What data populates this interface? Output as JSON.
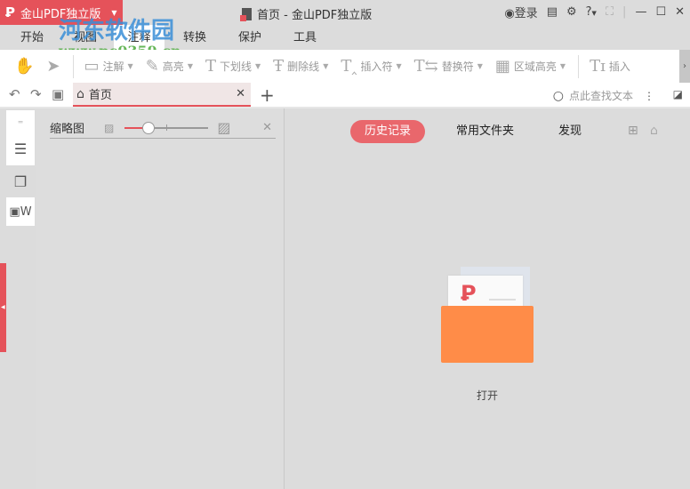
{
  "app": {
    "name": "金山PDF独立版",
    "window_title": "首页 - 金山PDF独立版",
    "login": "登录"
  },
  "watermark": {
    "name": "河东软件园",
    "url": "www.pc0359.cn"
  },
  "menu_tabs": [
    "开始",
    "视图",
    "注释",
    "转换",
    "保护",
    "工具"
  ],
  "active_menu_tab": "注释",
  "toolbar": {
    "items": [
      "注解",
      "高亮",
      "下划线",
      "删除线",
      "插入符",
      "替换符",
      "区域高亮",
      "插入"
    ]
  },
  "doc_tabs": [
    {
      "label": "首页"
    }
  ],
  "search": {
    "placeholder": "点此查找文本"
  },
  "thumbnail_panel": {
    "title": "缩略图",
    "zoom_level": 0.1
  },
  "main": {
    "tabs": [
      "历史记录",
      "常用文件夹",
      "发现"
    ],
    "active_tab": "历史记录",
    "open_label": "打开"
  },
  "colors": {
    "accent": "#e5525a",
    "folder": "#ff8c48"
  }
}
